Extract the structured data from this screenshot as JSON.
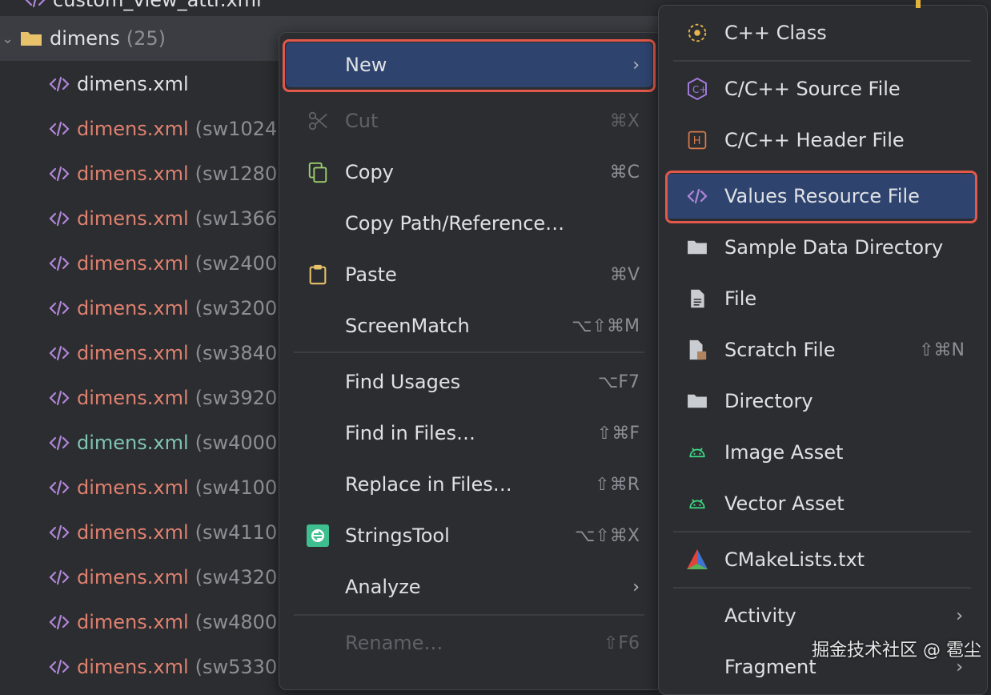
{
  "tree": {
    "top_partial": "custom_view_attr.xml",
    "folder": {
      "name": "dimens",
      "count": "(25)"
    },
    "files": [
      {
        "name": "dimens.xml",
        "qualifier": "",
        "color": "white"
      },
      {
        "name": "dimens.xml",
        "qualifier": "(sw1024",
        "color": "red"
      },
      {
        "name": "dimens.xml",
        "qualifier": "(sw1280",
        "color": "red"
      },
      {
        "name": "dimens.xml",
        "qualifier": "(sw1366",
        "color": "red"
      },
      {
        "name": "dimens.xml",
        "qualifier": "(sw2400",
        "color": "red"
      },
      {
        "name": "dimens.xml",
        "qualifier": "(sw3200",
        "color": "red"
      },
      {
        "name": "dimens.xml",
        "qualifier": "(sw3840",
        "color": "red"
      },
      {
        "name": "dimens.xml",
        "qualifier": "(sw3920",
        "color": "red"
      },
      {
        "name": "dimens.xml",
        "qualifier": "(sw4000",
        "color": "teal"
      },
      {
        "name": "dimens.xml",
        "qualifier": "(sw4100",
        "color": "red"
      },
      {
        "name": "dimens.xml",
        "qualifier": "(sw4110",
        "color": "red"
      },
      {
        "name": "dimens.xml",
        "qualifier": "(sw4320",
        "color": "red"
      },
      {
        "name": "dimens.xml",
        "qualifier": "(sw4800",
        "color": "red"
      },
      {
        "name": "dimens.xml",
        "qualifier": "(sw5330",
        "color": "red"
      }
    ]
  },
  "context_menu": {
    "items": [
      {
        "label": "New",
        "shortcut": "",
        "icon": "",
        "submenu": true,
        "selected": true
      },
      {
        "label": "Cut",
        "shortcut": "⌘X",
        "icon": "scissors-icon",
        "disabled": true
      },
      {
        "label": "Copy",
        "shortcut": "⌘C",
        "icon": "copy-icon"
      },
      {
        "label": "Copy Path/Reference…",
        "shortcut": "",
        "icon": ""
      },
      {
        "label": "Paste",
        "shortcut": "⌘V",
        "icon": "clipboard-icon"
      },
      {
        "label": "ScreenMatch",
        "shortcut": "⌥⇧⌘M",
        "icon": ""
      },
      {
        "label": "Find Usages",
        "shortcut": "⌥F7",
        "icon": ""
      },
      {
        "label": "Find in Files…",
        "shortcut": "⇧⌘F",
        "icon": ""
      },
      {
        "label": "Replace in Files…",
        "shortcut": "⇧⌘R",
        "icon": ""
      },
      {
        "label": "StringsTool",
        "shortcut": "⌥⇧⌘X",
        "icon": "stringstool-icon"
      },
      {
        "label": "Analyze",
        "shortcut": "",
        "icon": "",
        "submenu": true
      },
      {
        "label": "Rename…",
        "shortcut": "⇧F6",
        "icon": "",
        "disabled": true
      }
    ]
  },
  "submenu": {
    "items": [
      {
        "label": "C++ Class",
        "icon": "cpp-class-icon"
      },
      {
        "label": "C/C++ Source File",
        "icon": "cpp-source-icon"
      },
      {
        "label": "C/C++ Header File",
        "icon": "cpp-header-icon"
      },
      {
        "label": "Values Resource File",
        "icon": "xml-icon",
        "selected": true
      },
      {
        "label": "Sample Data Directory",
        "icon": "folder-icon"
      },
      {
        "label": "File",
        "icon": "file-icon"
      },
      {
        "label": "Scratch File",
        "icon": "scratch-file-icon",
        "shortcut": "⇧⌘N"
      },
      {
        "label": "Directory",
        "icon": "folder-icon"
      },
      {
        "label": "Image Asset",
        "icon": "android-icon"
      },
      {
        "label": "Vector Asset",
        "icon": "android-icon"
      },
      {
        "label": "CMakeLists.txt",
        "icon": "cmake-icon"
      },
      {
        "label": "Activity",
        "icon": "",
        "submenu": true
      },
      {
        "label": "Fragment",
        "icon": "",
        "submenu": true
      }
    ]
  },
  "watermark": "掘金技术社区 @ 雹尘",
  "colors": {
    "selection": "#2e436e",
    "highlight_border": "#e2584a",
    "red_file": "#e0806f",
    "teal_file": "#7fc4b5"
  }
}
